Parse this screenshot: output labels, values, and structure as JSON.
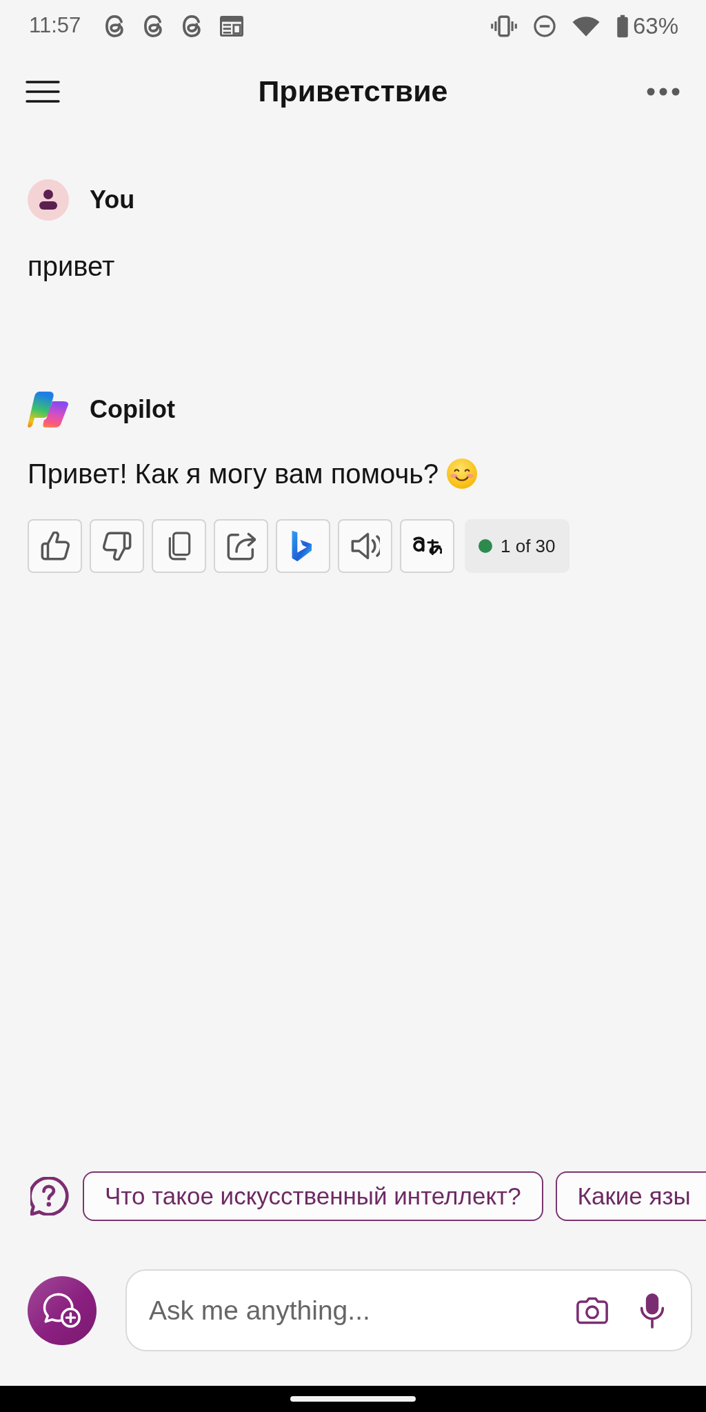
{
  "status_bar": {
    "time": "11:57",
    "battery": "63%"
  },
  "header": {
    "title": "Приветствие"
  },
  "messages": [
    {
      "kind": "user",
      "author": "You",
      "text": "привет"
    },
    {
      "kind": "bot",
      "author": "Copilot",
      "text": "Привет! Как я могу вам помочь?",
      "response_counter": "1 of 30"
    }
  ],
  "suggestions": [
    "Что такое искусственный интеллект?",
    "Какие язы"
  ],
  "composer": {
    "placeholder": "Ask me anything..."
  }
}
